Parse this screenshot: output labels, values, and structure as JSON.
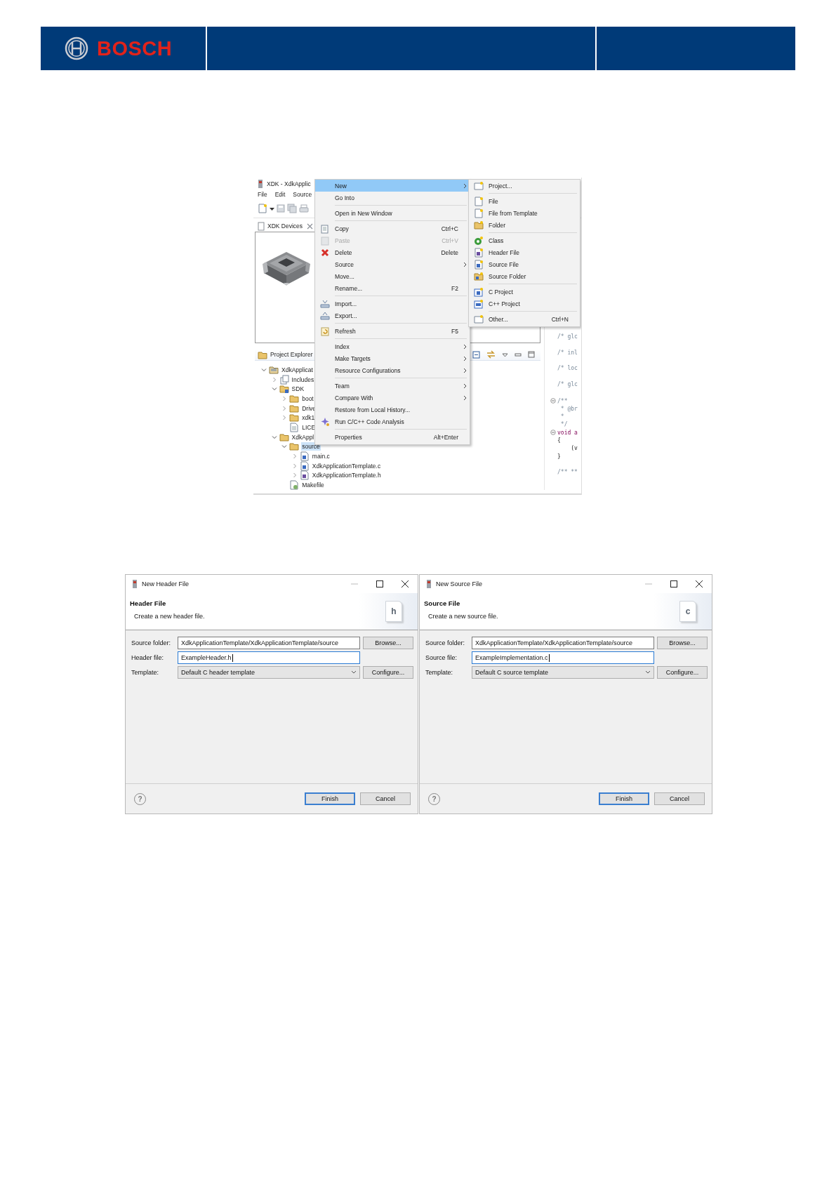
{
  "header": {
    "brand": "BOSCH"
  },
  "ide": {
    "title": "XDK - XdkApplic",
    "menubar": [
      "File",
      "Edit",
      "Source"
    ],
    "devices_tab": {
      "label": "XDK Devices"
    },
    "explorer_tab": {
      "label": "Project Explorer"
    },
    "tree": [
      {
        "label": "XdkApplicat",
        "kind": "project",
        "expandable": true,
        "expanded": true,
        "selected": false,
        "children": [
          {
            "label": "Includes",
            "kind": "includes",
            "expandable": true,
            "expanded": false,
            "selected": false
          },
          {
            "label": "SDK",
            "kind": "linked-folder",
            "expandable": true,
            "expanded": true,
            "selected": false,
            "children": [
              {
                "label": "boot",
                "kind": "folder",
                "expandable": true,
                "expanded": false,
                "selected": false
              },
              {
                "label": "Drive",
                "kind": "folder",
                "expandable": true,
                "expanded": false,
                "selected": false
              },
              {
                "label": "xdk1",
                "kind": "folder",
                "expandable": true,
                "expanded": false,
                "selected": false
              },
              {
                "label": "LICE",
                "kind": "text-file",
                "expandable": false,
                "selected": false
              }
            ]
          },
          {
            "label": "XdkAppl",
            "kind": "folder",
            "expandable": true,
            "expanded": true,
            "selected": false,
            "children": [
              {
                "label": "source",
                "kind": "folder",
                "expandable": true,
                "expanded": true,
                "selected": true,
                "children": [
                  {
                    "label": "main.c",
                    "kind": "c-file",
                    "expandable": true,
                    "expanded": false,
                    "selected": false
                  },
                  {
                    "label": "XdkApplicationTemplate.c",
                    "kind": "c-file",
                    "expandable": true,
                    "expanded": false,
                    "selected": false
                  },
                  {
                    "label": "XdkApplicationTemplate.h",
                    "kind": "h-file",
                    "expandable": true,
                    "expanded": false,
                    "selected": false
                  }
                ]
              },
              {
                "label": "Makefile",
                "kind": "makefile",
                "expandable": false,
                "selected": false
              }
            ]
          }
        ]
      }
    ],
    "editor": {
      "lines": [
        {
          "text": "/* glc",
          "fold": false
        },
        {
          "text": "/* inl",
          "fold": false
        },
        {
          "text": "/* loc",
          "fold": false
        },
        {
          "text": "/* glc",
          "fold": false
        },
        {
          "text": "/**",
          "fold": true
        },
        {
          "text": " * @br",
          "fold": false
        },
        {
          "text": " *",
          "fold": false
        },
        {
          "text": " */",
          "fold": false
        },
        {
          "text": "void a",
          "fold": true
        },
        {
          "text": "{",
          "fold": false
        },
        {
          "text": "    (v",
          "fold": false
        },
        {
          "text": "}",
          "fold": false
        },
        {
          "fold": false
        },
        {
          "text": "/** **",
          "fold": false
        }
      ]
    }
  },
  "context_menu": {
    "groups": [
      {
        "items": [
          {
            "label": "New",
            "submenu": true,
            "disabled": false,
            "selected": true
          },
          {
            "label": "Go Into",
            "submenu": false,
            "disabled": false,
            "selected": false
          }
        ]
      },
      {
        "items": [
          {
            "label": "Open in New Window",
            "submenu": false,
            "disabled": false,
            "selected": false
          }
        ]
      },
      {
        "items": [
          {
            "label": "Copy",
            "shortcut": "Ctrl+C",
            "submenu": false,
            "disabled": false,
            "selected": false
          },
          {
            "label": "Paste",
            "shortcut": "Ctrl+V",
            "submenu": false,
            "disabled": true,
            "selected": false
          },
          {
            "label": "Delete",
            "shortcut": "Delete",
            "submenu": false,
            "disabled": false,
            "selected": false
          },
          {
            "label": "Source",
            "submenu": true,
            "disabled": false,
            "selected": false
          },
          {
            "label": "Move...",
            "submenu": false,
            "disabled": false,
            "selected": false
          },
          {
            "label": "Rename...",
            "shortcut": "F2",
            "submenu": false,
            "disabled": false,
            "selected": false
          }
        ]
      },
      {
        "items": [
          {
            "label": "Import...",
            "submenu": false,
            "disabled": false,
            "selected": false
          },
          {
            "label": "Export...",
            "submenu": false,
            "disabled": false,
            "selected": false
          }
        ]
      },
      {
        "items": [
          {
            "label": "Refresh",
            "shortcut": "F5",
            "submenu": false,
            "disabled": false,
            "selected": false
          }
        ]
      },
      {
        "items": [
          {
            "label": "Index",
            "submenu": true,
            "disabled": false,
            "selected": false
          },
          {
            "label": "Make Targets",
            "submenu": true,
            "disabled": false,
            "selected": false
          },
          {
            "label": "Resource Configurations",
            "submenu": true,
            "disabled": false,
            "selected": false
          }
        ]
      },
      {
        "items": [
          {
            "label": "Team",
            "submenu": true,
            "disabled": false,
            "selected": false
          },
          {
            "label": "Compare With",
            "submenu": true,
            "disabled": false,
            "selected": false
          },
          {
            "label": "Restore from Local History...",
            "submenu": false,
            "disabled": false,
            "selected": false
          },
          {
            "label": "Run C/C++ Code Analysis",
            "submenu": false,
            "disabled": false,
            "selected": false
          }
        ]
      },
      {
        "items": [
          {
            "label": "Properties",
            "shortcut": "Alt+Enter",
            "submenu": false,
            "disabled": false,
            "selected": false
          }
        ]
      }
    ]
  },
  "new_submenu": {
    "groups": [
      {
        "items": [
          {
            "label": "Project..."
          }
        ]
      },
      {
        "items": [
          {
            "label": "File"
          },
          {
            "label": "File from Template"
          },
          {
            "label": "Folder"
          }
        ]
      },
      {
        "items": [
          {
            "label": "Class"
          },
          {
            "label": "Header File"
          },
          {
            "label": "Source File"
          },
          {
            "label": "Source Folder"
          }
        ]
      },
      {
        "items": [
          {
            "label": "C Project"
          },
          {
            "label": "C++ Project"
          }
        ]
      },
      {
        "items": [
          {
            "label": "Other...",
            "shortcut": "Ctrl+N"
          }
        ]
      }
    ]
  },
  "dialogs": [
    {
      "title": "New Header File",
      "heading": "Header File",
      "description": "Create a new header file.",
      "badge_letter": "h",
      "fields": [
        {
          "label": "Source folder:",
          "kind": "text",
          "value": "XdkApplicationTemplate/XdkApplicationTemplate/source",
          "focused": false,
          "button": "Browse..."
        },
        {
          "label": "Header file:",
          "kind": "text",
          "value": "ExampleHeader.h",
          "focused": true
        },
        {
          "label": "Template:",
          "kind": "combo",
          "value": "Default C header template",
          "focused": false,
          "button": "Configure..."
        }
      ],
      "help": "?",
      "buttons": [
        {
          "label": "Finish",
          "default": true
        },
        {
          "label": "Cancel",
          "default": false
        }
      ]
    },
    {
      "title": "New Source File",
      "heading": "Source File",
      "description": "Create a new source file.",
      "badge_letter": "c",
      "fields": [
        {
          "label": "Source folder:",
          "kind": "text",
          "value": "XdkApplicationTemplate/XdkApplicationTemplate/source",
          "focused": false,
          "button": "Browse..."
        },
        {
          "label": "Source file:",
          "kind": "text",
          "value": "ExampleImplementation.c",
          "focused": true
        },
        {
          "label": "Template:",
          "kind": "combo",
          "value": "Default C source template",
          "focused": false,
          "button": "Configure..."
        }
      ],
      "help": "?",
      "buttons": [
        {
          "label": "Finish",
          "default": true
        },
        {
          "label": "Cancel",
          "default": false
        }
      ]
    }
  ]
}
